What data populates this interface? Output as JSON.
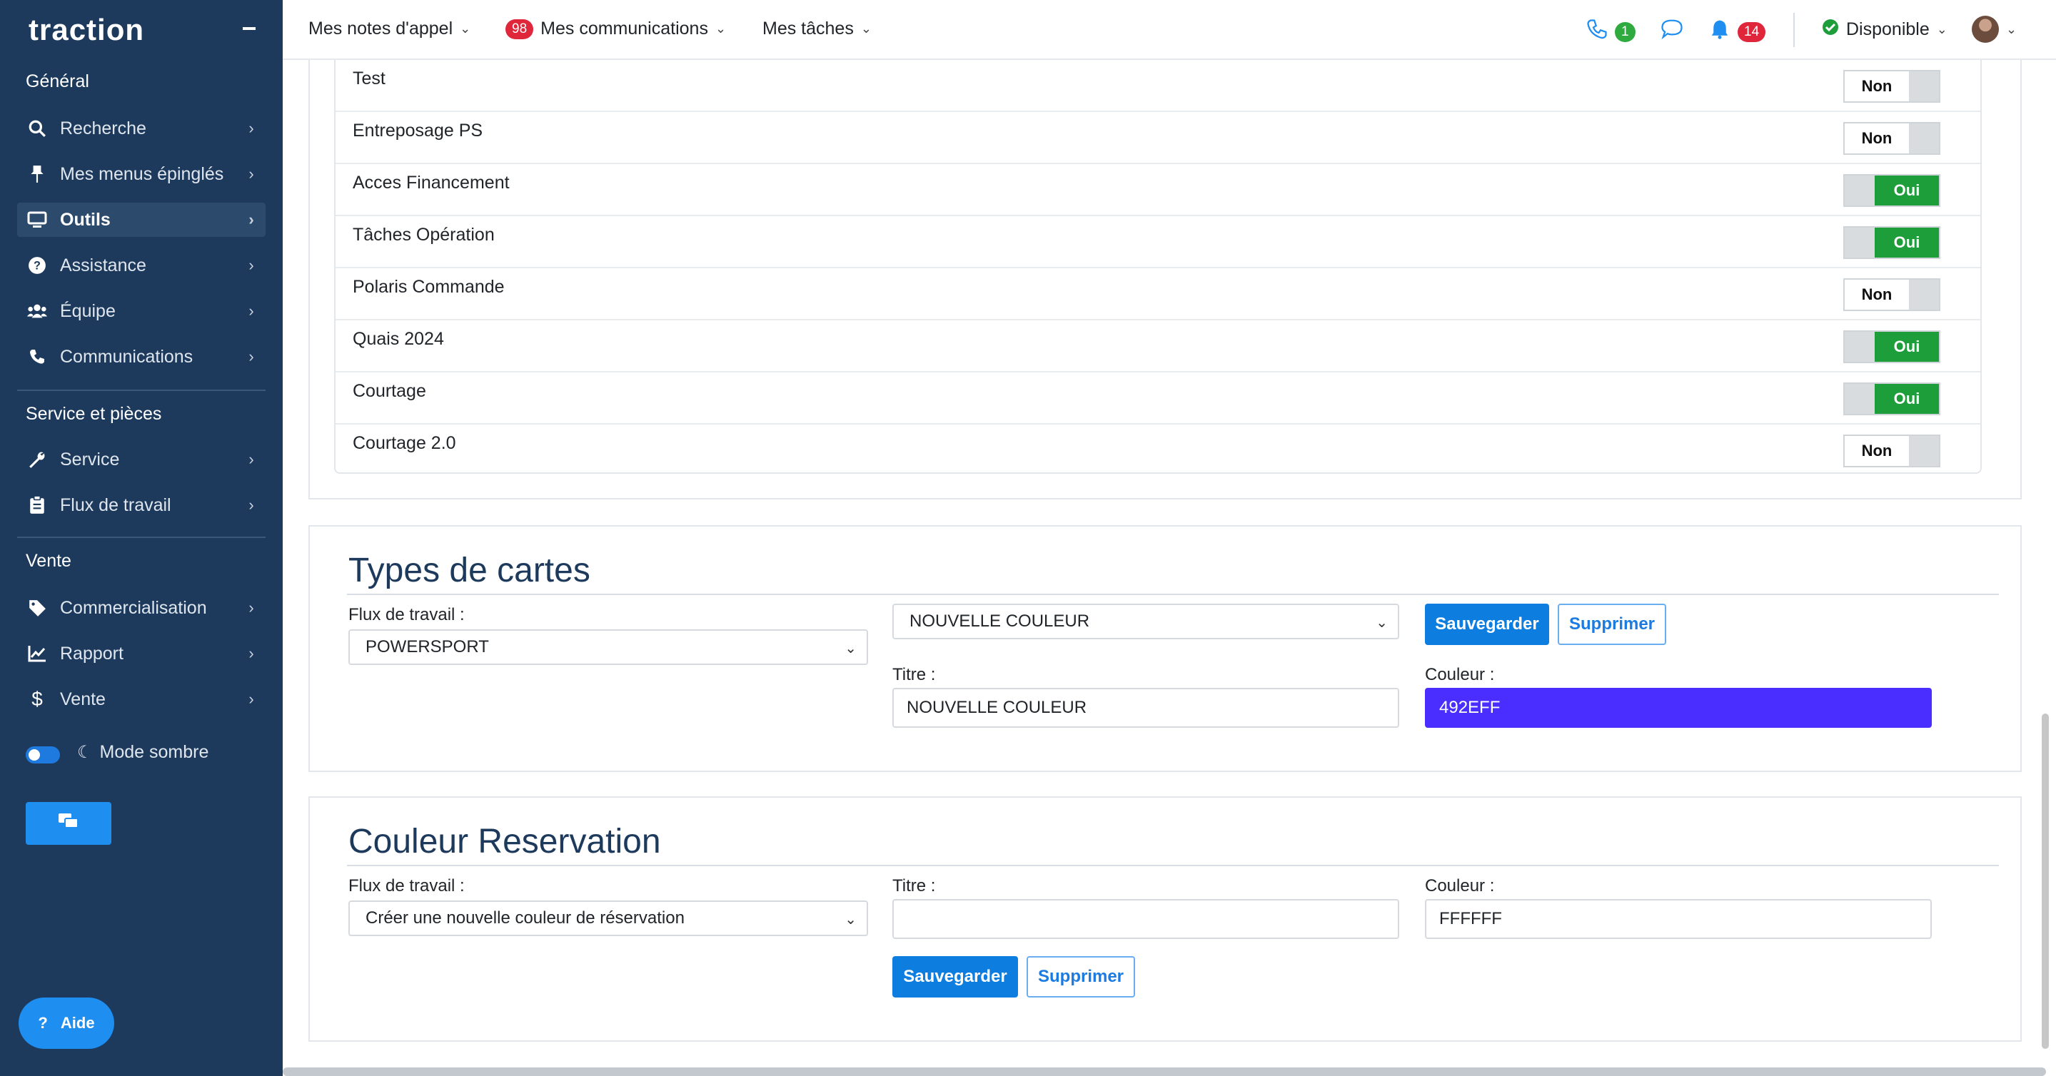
{
  "brand": "traction",
  "sidebar": {
    "sections": [
      {
        "title": "Général"
      },
      {
        "title": "Service et pièces"
      },
      {
        "title": "Vente"
      }
    ],
    "items": [
      {
        "label": "Recherche",
        "icon": "search-icon"
      },
      {
        "label": "Mes menus épinglés",
        "icon": "pin-icon"
      },
      {
        "label": "Outils",
        "icon": "monitor-icon",
        "active": true
      },
      {
        "label": "Assistance",
        "icon": "question-circle-icon"
      },
      {
        "label": "Équipe",
        "icon": "users-icon"
      },
      {
        "label": "Communications",
        "icon": "phone-icon"
      },
      {
        "label": "Service",
        "icon": "wrench-icon"
      },
      {
        "label": "Flux de travail",
        "icon": "clipboard-icon"
      },
      {
        "label": "Commercialisation",
        "icon": "tag-icon"
      },
      {
        "label": "Rapport",
        "icon": "chart-icon"
      },
      {
        "label": "Vente",
        "icon": "dollar-icon"
      }
    ],
    "dark_mode_label": "Mode sombre",
    "help_label": "Aide"
  },
  "topbar": {
    "call_notes": "Mes notes d'appel",
    "communications_badge": "98",
    "communications": "Mes communications",
    "tasks": "Mes tâches",
    "phone_badge": "1",
    "bell_badge": "14",
    "status": "Disponible"
  },
  "modules": [
    {
      "label": "Test",
      "value": "Non"
    },
    {
      "label": "Entreposage PS",
      "value": "Non"
    },
    {
      "label": "Acces Financement",
      "value": "Oui"
    },
    {
      "label": "Tâches Opération",
      "value": "Oui"
    },
    {
      "label": "Polaris Commande",
      "value": "Non"
    },
    {
      "label": "Quais 2024",
      "value": "Oui"
    },
    {
      "label": "Courtage",
      "value": "Oui"
    },
    {
      "label": "Courtage 2.0",
      "value": "Non"
    }
  ],
  "card_types": {
    "title": "Types de cartes",
    "workflow_label": "Flux de travail :",
    "workflow_value": "POWERSPORT",
    "type_select_value": "NOUVELLE COULEUR",
    "save_label": "Sauvegarder",
    "delete_label": "Supprimer",
    "title_label": "Titre :",
    "title_value": "NOUVELLE COULEUR",
    "color_label": "Couleur :",
    "color_value": "492EFF"
  },
  "reservation_color": {
    "title": "Couleur Reservation",
    "workflow_label": "Flux de travail :",
    "workflow_value": "Créer une nouvelle couleur de réservation",
    "title_label": "Titre :",
    "title_value": "",
    "color_label": "Couleur :",
    "color_value": "FFFFFF",
    "save_label": "Sauvegarder",
    "delete_label": "Supprimer"
  },
  "colors": {
    "sidebar_bg": "#1d3a5c",
    "primary": "#0d7de0",
    "success": "#1e9d3b",
    "danger": "#e0263a",
    "card_color": "#492eff"
  }
}
